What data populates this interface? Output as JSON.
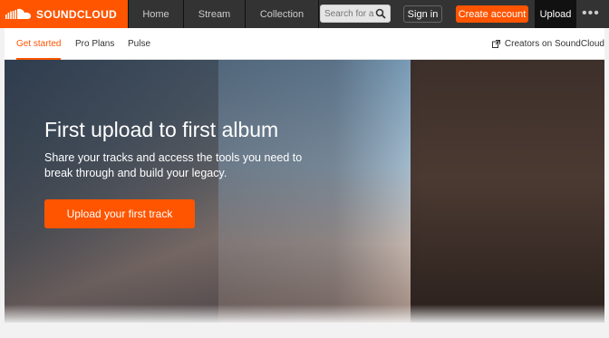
{
  "brand": {
    "name": "SOUNDCLOUD",
    "accent": "#ff5500",
    "nav_bg": "#333333"
  },
  "topnav": {
    "tabs": [
      "Home",
      "Stream",
      "Collection"
    ],
    "search_placeholder": "Search for a",
    "search_icon": "search-icon",
    "signin_label": "Sign in",
    "create_label": "Create account",
    "upload_label": "Upload",
    "more_label": "•••"
  },
  "subnav": {
    "tabs": [
      {
        "label": "Get started",
        "active": true
      },
      {
        "label": "Pro Plans",
        "active": false
      },
      {
        "label": "Pulse",
        "active": false
      }
    ],
    "creators_label": "Creators on SoundCloud",
    "creators_icon": "external-link-icon"
  },
  "hero": {
    "title": "First upload to first album",
    "subtitle": "Share your tracks and access the tools you need to break through and build your legacy.",
    "cta_label": "Upload your first track"
  }
}
